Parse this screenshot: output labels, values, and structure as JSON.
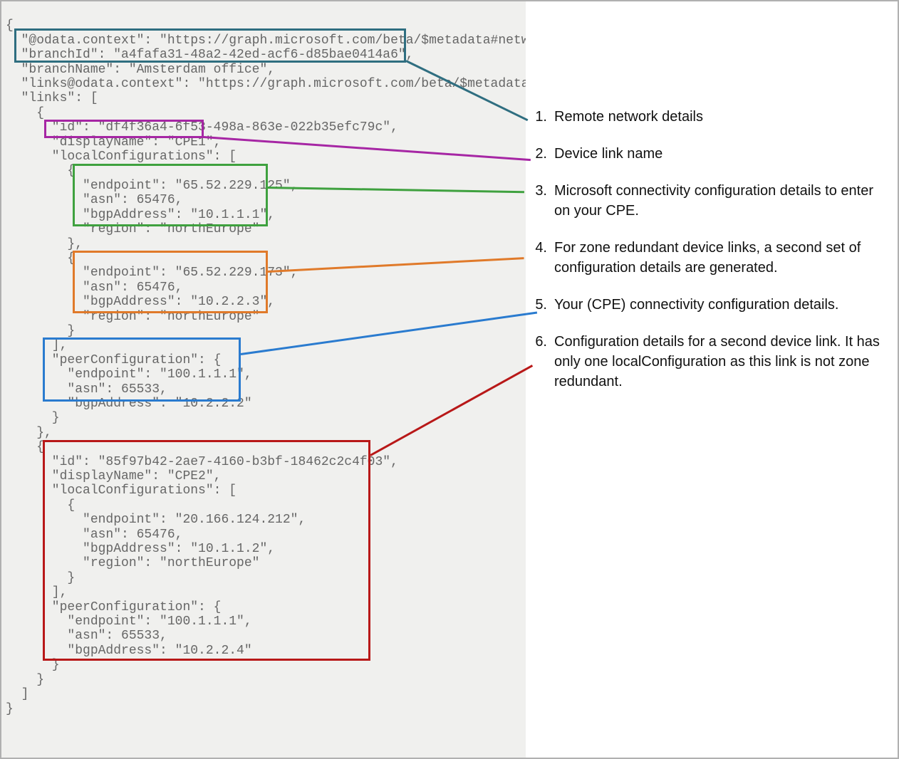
{
  "code": {
    "l01": "{",
    "l02": "  \"@odata.context\": \"https://graph.microsoft.com/beta/$metadata#networkAcc",
    "l03": "  \"branchId\": \"a4fafa31-48a2-42ed-acf6-d85bae0414a6\",",
    "l04": "  \"branchName\": \"Amsterdam office\",",
    "l05": "  \"links@odata.context\": \"https://graph.microsoft.com/beta/$metadata#netwo",
    "l06": "  \"links\": [",
    "l07": "    {",
    "l08": "      \"id\": \"df4f36a4-6f53-498a-863e-022b35efc79c\",",
    "l09": "      \"displayName\": \"CPE1\",",
    "l10": "      \"localConfigurations\": [",
    "l11": "        {",
    "l12": "          \"endpoint\": \"65.52.229.125\",",
    "l13": "          \"asn\": 65476,",
    "l14": "          \"bgpAddress\": \"10.1.1.1\",",
    "l15": "          \"region\": \"northEurope\"",
    "l16": "        },",
    "l17": "        {",
    "l18": "          \"endpoint\": \"65.52.229.173\",",
    "l19": "          \"asn\": 65476,",
    "l20": "          \"bgpAddress\": \"10.2.2.3\",",
    "l21": "          \"region\": \"northEurope\"",
    "l22": "        }",
    "l23": "      ],",
    "l24": "      \"peerConfiguration\": {",
    "l25": "        \"endpoint\": \"100.1.1.1\",",
    "l26": "        \"asn\": 65533,",
    "l27": "        \"bgpAddress\": \"10.2.2.2\"",
    "l28": "      }",
    "l29": "    },",
    "l30": "    {",
    "l31": "      \"id\": \"85f97b42-2ae7-4160-b3bf-18462c2c4f03\",",
    "l32": "      \"displayName\": \"CPE2\",",
    "l33": "      \"localConfigurations\": [",
    "l34": "        {",
    "l35": "          \"endpoint\": \"20.166.124.212\",",
    "l36": "          \"asn\": 65476,",
    "l37": "          \"bgpAddress\": \"10.1.1.2\",",
    "l38": "          \"region\": \"northEurope\"",
    "l39": "        }",
    "l40": "      ],",
    "l41": "      \"peerConfiguration\": {",
    "l42": "        \"endpoint\": \"100.1.1.1\",",
    "l43": "        \"asn\": 65533,",
    "l44": "        \"bgpAddress\": \"10.2.2.4\"",
    "l45": "      }",
    "l46": "    }",
    "l47": "  ]",
    "l48": "}"
  },
  "legend": {
    "n1": "1.",
    "t1": "Remote network details",
    "n2": "2.",
    "t2": "Device link name",
    "n3": "3.",
    "t3": "Microsoft connectivity configuration details to enter on your CPE.",
    "n4": "4.",
    "t4": "For zone redundant device links, a second set of configuration details are generated.",
    "n5": "5.",
    "t5": "Your (CPE) connectivity configuration details.",
    "n6": "6.",
    "t6": "Configuration details for a second device link. It has only one localConfiguration as this link is not zone redundant."
  }
}
